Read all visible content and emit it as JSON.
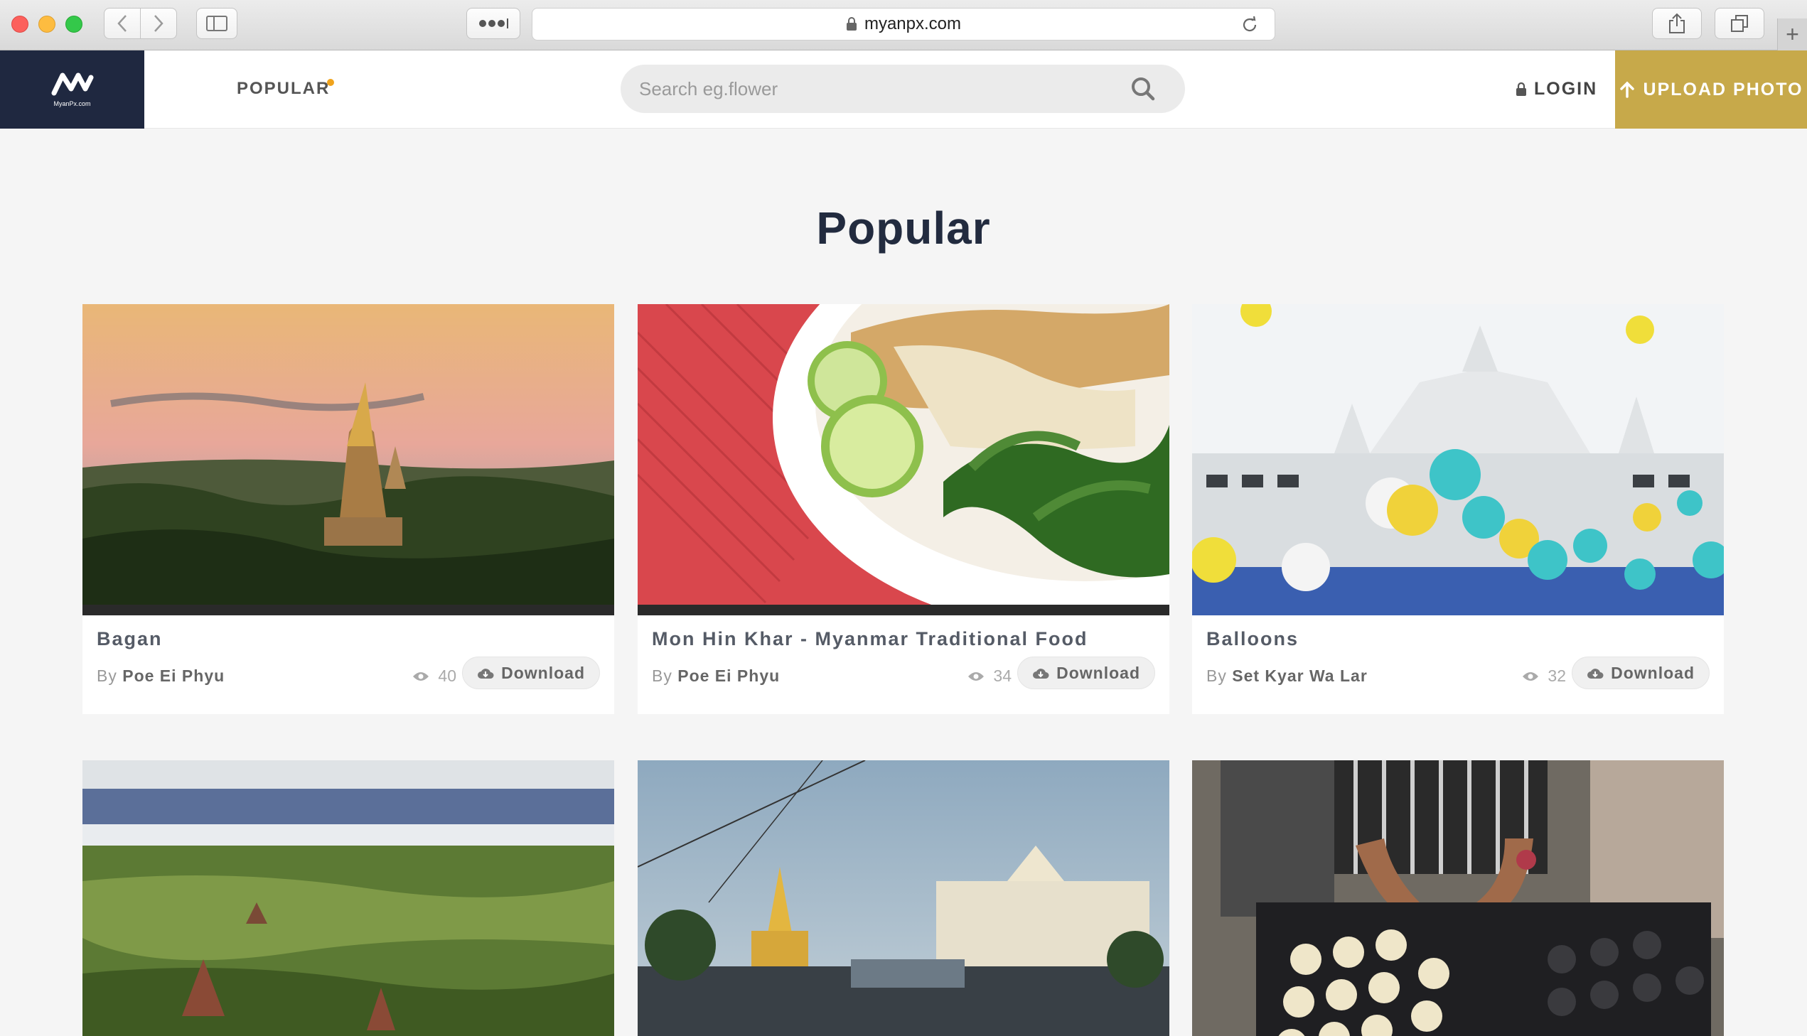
{
  "browser": {
    "url": "myanpx.com"
  },
  "header": {
    "logo_text": "MyanPx.com",
    "nav_popular": "POPULAR",
    "search_placeholder": "Search eg.flower",
    "login": "LOGIN",
    "upload": "UPLOAD PHOTO"
  },
  "main": {
    "title": "Popular",
    "download_label": "Download",
    "by_label": "By",
    "photos": [
      {
        "title": "Bagan",
        "author": "Poe Ei Phyu",
        "views": "40",
        "icon": "temple-sunset-photo"
      },
      {
        "title": "Mon Hin Khar - Myanmar Traditional Food",
        "author": "Poe Ei Phyu",
        "views": "34",
        "icon": "food-bowl-photo"
      },
      {
        "title": "Balloons",
        "author": "Set Kyar Wa Lar",
        "views": "32",
        "icon": "balloons-building-photo"
      }
    ]
  },
  "colors": {
    "navy": "#1f2840",
    "gold": "#c7a94a",
    "accent_dot": "#f0a31c"
  }
}
